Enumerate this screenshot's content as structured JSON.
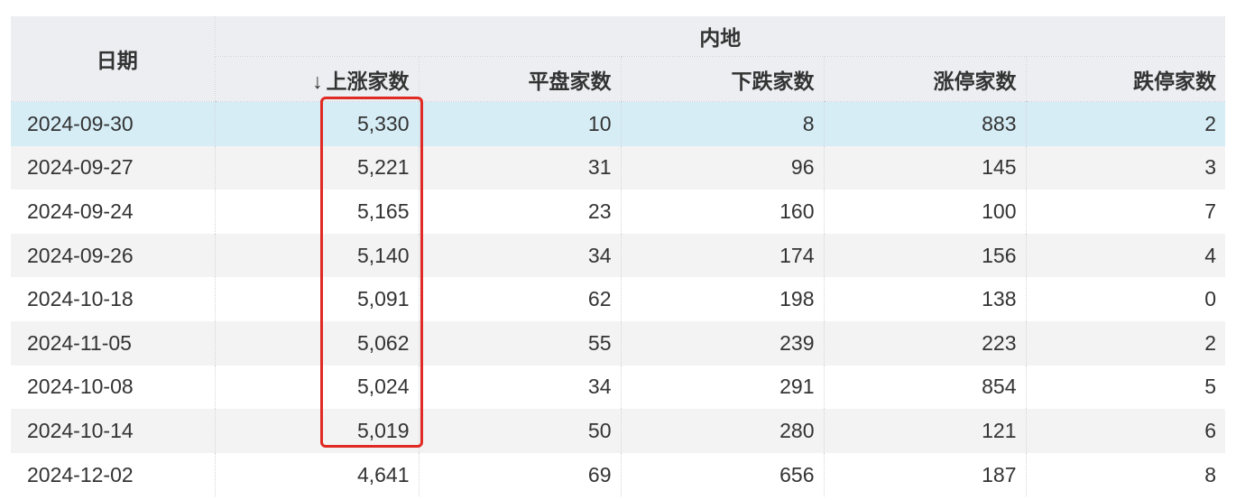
{
  "table": {
    "date_header": "日期",
    "group_header": "内地",
    "sort_indicator": "↓",
    "columns": [
      "上涨家数",
      "平盘家数",
      "下跌家数",
      "涨停家数",
      "跌停家数"
    ],
    "rows": [
      {
        "date": "2024-09-30",
        "up": "5,330",
        "flat": "10",
        "down": "8",
        "limit_up": "883",
        "limit_down": "2"
      },
      {
        "date": "2024-09-27",
        "up": "5,221",
        "flat": "31",
        "down": "96",
        "limit_up": "145",
        "limit_down": "3"
      },
      {
        "date": "2024-09-24",
        "up": "5,165",
        "flat": "23",
        "down": "160",
        "limit_up": "100",
        "limit_down": "7"
      },
      {
        "date": "2024-09-26",
        "up": "5,140",
        "flat": "34",
        "down": "174",
        "limit_up": "156",
        "limit_down": "4"
      },
      {
        "date": "2024-10-18",
        "up": "5,091",
        "flat": "62",
        "down": "198",
        "limit_up": "138",
        "limit_down": "0"
      },
      {
        "date": "2024-11-05",
        "up": "5,062",
        "flat": "55",
        "down": "239",
        "limit_up": "223",
        "limit_down": "2"
      },
      {
        "date": "2024-10-08",
        "up": "5,024",
        "flat": "34",
        "down": "291",
        "limit_up": "854",
        "limit_down": "5"
      },
      {
        "date": "2024-10-14",
        "up": "5,019",
        "flat": "50",
        "down": "280",
        "limit_up": "121",
        "limit_down": "6"
      },
      {
        "date": "2024-12-02",
        "up": "4,641",
        "flat": "69",
        "down": "656",
        "limit_up": "187",
        "limit_down": "8"
      }
    ]
  },
  "colors": {
    "header_bg": "#eceef1",
    "selected_row_bg": "#d6edf6",
    "stripe_bg": "#f3f3f3",
    "highlight_box": "#e02b25"
  }
}
